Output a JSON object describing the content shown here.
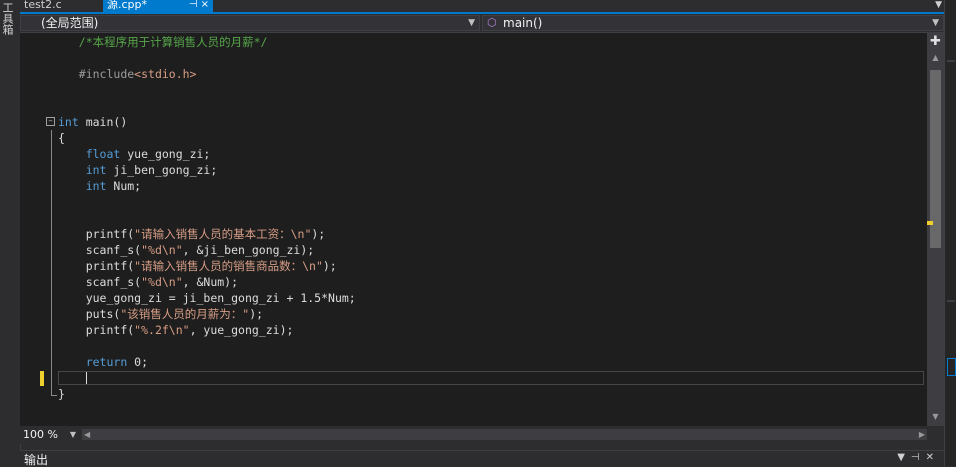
{
  "left_strip": {
    "label": "工具箱"
  },
  "tabs": [
    {
      "label": "test2.c",
      "active": false
    },
    {
      "label": "源.cpp*",
      "active": true
    }
  ],
  "tab_icons": {
    "pin": "pin-icon",
    "close": "×"
  },
  "nav": {
    "scope": "(全局范围)",
    "function": "main()",
    "function_icon": "cube-icon"
  },
  "editor": {
    "comment": "/*本程序用于计算销售人员的月薪*/",
    "include_directive": "#include",
    "include_file": "<stdio.h>",
    "main_kw": "int",
    "main_sig": " main()",
    "open_brace": "{",
    "decl1_kw": "float",
    "decl1_rest": " yue_gong_zi;",
    "decl2_kw": "int",
    "decl2_rest": " ji_ben_gong_zi;",
    "decl3_kw": "int",
    "decl3_rest": " Num;",
    "l1_a": "printf(",
    "l1_str": "\"请输入销售人员的基本工资：\\n\"",
    "l1_b": ");",
    "l2_a": "scanf_s(",
    "l2_str": "\"%d\\n\"",
    "l2_b": ", &ji_ben_gong_zi);",
    "l3_a": "printf(",
    "l3_str": "\"请输入销售人员的销售商品数：\\n\"",
    "l3_b": ");",
    "l4_a": "scanf_s(",
    "l4_str": "\"%d\\n\"",
    "l4_b": ", &Num);",
    "l5": "yue_gong_zi = ji_ben_gong_zi + 1.5*Num;",
    "l6_a": "puts(",
    "l6_str": "\"该销售人员的月薪为：\"",
    "l6_b": ");",
    "l7_a": "printf(",
    "l7_str": "\"%.2f\\n\"",
    "l7_b": ", yue_gong_zi);",
    "ret_kw": "return",
    "ret_rest": " 0;",
    "close_brace": "}"
  },
  "zoom": {
    "value": "100 %"
  },
  "output": {
    "title": "输出"
  },
  "colors": {
    "accent": "#007acc",
    "editor_bg": "#1e1e1e",
    "keyword": "#569cd6",
    "string": "#d69d85",
    "comment": "#57a64a",
    "change_marker": "#efcf2e"
  }
}
